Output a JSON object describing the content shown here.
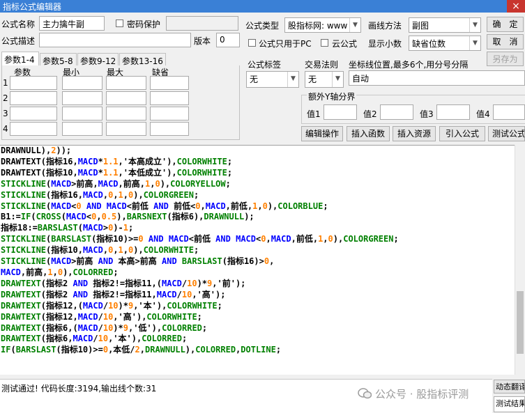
{
  "window": {
    "title": "指标公式编辑器",
    "close_glyph": "×"
  },
  "form": {
    "name_label": "公式名称",
    "name_value": "主力擒牛副",
    "password_label": "密码保护",
    "desc_label": "公式描述",
    "desc_value": "",
    "version_label": "版本",
    "version_value": "0",
    "type_label": "公式类型",
    "type_value": "股指标网: www",
    "draw_label": "画线方法",
    "draw_value": "副图",
    "pc_only_label": "公式只用于PC",
    "cloud_label": "云公式",
    "decimal_label": "显示小数",
    "decimal_value": "缺省位数"
  },
  "buttons": {
    "ok": "确　定",
    "cancel": "取　消",
    "save_as": "另存为",
    "edit_ops": "编辑操作",
    "insert_func": "插入函数",
    "insert_res": "插入资源",
    "import_formula": "引入公式",
    "test_formula": "测试公式"
  },
  "tabs": [
    "参数1-4",
    "参数5-8",
    "参数9-12",
    "参数13-16"
  ],
  "params": {
    "headers": [
      "参数",
      "最小",
      "最大",
      "缺省"
    ],
    "rows": [
      "1",
      "2",
      "3",
      "4"
    ]
  },
  "right_panel": {
    "tag_label": "公式标签",
    "tag_value": "无",
    "trade_label": "交易法则",
    "trade_value": "无",
    "coord_label": "坐标线位置,最多6个,用分号分隔",
    "coord_value": "自动",
    "extra_y_label": "额外Y轴分界",
    "value_labels": [
      "值1",
      "值2",
      "值3",
      "值4"
    ]
  },
  "status": {
    "message": "测试通过! 代码长度:3194,输出线个数:31"
  },
  "side_fragments": {
    "dynamic_translate": "动态翻译",
    "test_result": "测试结果"
  },
  "watermark": {
    "text": "公众号 · 股指标评测"
  },
  "colors": {
    "titlebar": "#3a80d6",
    "close": "#c8352e",
    "keyword_blue": "#0000ff",
    "green": "#008000",
    "number_orange": "#ff8000"
  },
  "code_lines": [
    [
      [
        "b",
        "DRAWNULL),"
      ],
      [
        "o",
        "2"
      ],
      [
        "b",
        "));"
      ]
    ],
    [
      [
        "b",
        "DRAWTEXT(指标16,"
      ],
      [
        "bl",
        "MACD"
      ],
      [
        "b",
        "*"
      ],
      [
        "o",
        "1.1"
      ],
      [
        "b",
        ",'本高成立'),"
      ],
      [
        "g",
        "COLORWHITE"
      ],
      [
        "b",
        ";"
      ]
    ],
    [
      [
        "b",
        "DRAWTEXT(指标10,"
      ],
      [
        "bl",
        "MACD"
      ],
      [
        "b",
        "*"
      ],
      [
        "o",
        "1.1"
      ],
      [
        "b",
        ",'本低成立'),"
      ],
      [
        "g",
        "COLORWHITE"
      ],
      [
        "b",
        ";"
      ]
    ],
    [
      [
        "g",
        "STICKLINE"
      ],
      [
        "b",
        "("
      ],
      [
        "bl",
        "MACD"
      ],
      [
        "b",
        ">前高,"
      ],
      [
        "bl",
        "MACD"
      ],
      [
        "b",
        ",前高,"
      ],
      [
        "o",
        "1"
      ],
      [
        "b",
        ","
      ],
      [
        "o",
        "0"
      ],
      [
        "b",
        "),"
      ],
      [
        "g",
        "COLORYELLOW"
      ],
      [
        "b",
        ";"
      ]
    ],
    [
      [
        "g",
        "STICKLINE"
      ],
      [
        "b",
        "(指标16,"
      ],
      [
        "bl",
        "MACD"
      ],
      [
        "b",
        ","
      ],
      [
        "o",
        "0"
      ],
      [
        "b",
        ","
      ],
      [
        "o",
        "1"
      ],
      [
        "b",
        ","
      ],
      [
        "o",
        "0"
      ],
      [
        "b",
        "),"
      ],
      [
        "g",
        "COLORGREEN"
      ],
      [
        "b",
        ";"
      ]
    ],
    [
      [
        "g",
        "STICKLINE"
      ],
      [
        "b",
        "("
      ],
      [
        "bl",
        "MACD"
      ],
      [
        "b",
        "<"
      ],
      [
        "o",
        "0"
      ],
      [
        "b",
        " "
      ],
      [
        "bl",
        "AND"
      ],
      [
        "b",
        " "
      ],
      [
        "bl",
        "MACD"
      ],
      [
        "b",
        "<前低 "
      ],
      [
        "bl",
        "AND"
      ],
      [
        "b",
        " 前低<"
      ],
      [
        "o",
        "0"
      ],
      [
        "b",
        ","
      ],
      [
        "bl",
        "MACD"
      ],
      [
        "b",
        ",前低,"
      ],
      [
        "o",
        "1"
      ],
      [
        "b",
        ","
      ],
      [
        "o",
        "0"
      ],
      [
        "b",
        "),"
      ],
      [
        "g",
        "COLORBLUE"
      ],
      [
        "b",
        ";"
      ]
    ],
    [
      [
        "b",
        "B1:="
      ],
      [
        "g",
        "IF"
      ],
      [
        "b",
        "("
      ],
      [
        "g",
        "CROSS"
      ],
      [
        "b",
        "("
      ],
      [
        "bl",
        "MACD"
      ],
      [
        "b",
        "<"
      ],
      [
        "o",
        "0"
      ],
      [
        "b",
        ","
      ],
      [
        "o",
        "0.5"
      ],
      [
        "b",
        "),"
      ],
      [
        "g",
        "BARSNEXT"
      ],
      [
        "b",
        "(指标6),"
      ],
      [
        "g",
        "DRAWNULL"
      ],
      [
        "b",
        ");"
      ]
    ],
    [
      [
        "b",
        "指标18:="
      ],
      [
        "g",
        "BARSLAST"
      ],
      [
        "b",
        "("
      ],
      [
        "bl",
        "MACD"
      ],
      [
        "b",
        ">"
      ],
      [
        "o",
        "0"
      ],
      [
        "b",
        ")-"
      ],
      [
        "o",
        "1"
      ],
      [
        "b",
        ";"
      ]
    ],
    [
      [
        "g",
        "STICKLINE"
      ],
      [
        "b",
        "("
      ],
      [
        "g",
        "BARSLAST"
      ],
      [
        "b",
        "(指标10)>="
      ],
      [
        "o",
        "0"
      ],
      [
        "b",
        " "
      ],
      [
        "bl",
        "AND"
      ],
      [
        "b",
        " "
      ],
      [
        "bl",
        "MACD"
      ],
      [
        "b",
        "<前低 "
      ],
      [
        "bl",
        "AND"
      ],
      [
        "b",
        " "
      ],
      [
        "bl",
        "MACD"
      ],
      [
        "b",
        "<"
      ],
      [
        "o",
        "0"
      ],
      [
        "b",
        ","
      ],
      [
        "bl",
        "MACD"
      ],
      [
        "b",
        ",前低,"
      ],
      [
        "o",
        "1"
      ],
      [
        "b",
        ","
      ],
      [
        "o",
        "0"
      ],
      [
        "b",
        "),"
      ],
      [
        "g",
        "COLORGREEN"
      ],
      [
        "b",
        ";"
      ]
    ],
    [
      [
        "g",
        "STICKLINE"
      ],
      [
        "b",
        "(指标10,"
      ],
      [
        "bl",
        "MACD"
      ],
      [
        "b",
        ","
      ],
      [
        "o",
        "0"
      ],
      [
        "b",
        ","
      ],
      [
        "o",
        "1"
      ],
      [
        "b",
        ","
      ],
      [
        "o",
        "0"
      ],
      [
        "b",
        "),"
      ],
      [
        "g",
        "COLORWHITE"
      ],
      [
        "b",
        ";"
      ]
    ],
    [
      [
        "g",
        "STICKLINE"
      ],
      [
        "b",
        "("
      ],
      [
        "bl",
        "MACD"
      ],
      [
        "b",
        ">前高 "
      ],
      [
        "bl",
        "AND"
      ],
      [
        "b",
        " 本高>前高 "
      ],
      [
        "bl",
        "AND"
      ],
      [
        "b",
        " "
      ],
      [
        "g",
        "BARSLAST"
      ],
      [
        "b",
        "(指标16)>"
      ],
      [
        "o",
        "0"
      ],
      [
        "b",
        ","
      ]
    ],
    [
      [
        "bl",
        "MACD"
      ],
      [
        "b",
        ",前高,"
      ],
      [
        "o",
        "1"
      ],
      [
        "b",
        ","
      ],
      [
        "o",
        "0"
      ],
      [
        "b",
        "),"
      ],
      [
        "g",
        "COLORRED"
      ],
      [
        "b",
        ";"
      ]
    ],
    [
      [
        "g",
        "DRAWTEXT"
      ],
      [
        "b",
        "(指标2 "
      ],
      [
        "bl",
        "AND"
      ],
      [
        "b",
        " 指标2!=指标11,("
      ],
      [
        "bl",
        "MACD"
      ],
      [
        "b",
        "/"
      ],
      [
        "o",
        "10"
      ],
      [
        "b",
        ")*"
      ],
      [
        "o",
        "9"
      ],
      [
        "b",
        ",'前');"
      ]
    ],
    [
      [
        "g",
        "DRAWTEXT"
      ],
      [
        "b",
        "(指标2 "
      ],
      [
        "bl",
        "AND"
      ],
      [
        "b",
        " 指标2!=指标11,"
      ],
      [
        "bl",
        "MACD"
      ],
      [
        "b",
        "/"
      ],
      [
        "o",
        "10"
      ],
      [
        "b",
        ",'高');"
      ]
    ],
    [
      [
        "g",
        "DRAWTEXT"
      ],
      [
        "b",
        "(指标12,("
      ],
      [
        "bl",
        "MACD"
      ],
      [
        "b",
        "/"
      ],
      [
        "o",
        "10"
      ],
      [
        "b",
        ")*"
      ],
      [
        "o",
        "9"
      ],
      [
        "b",
        ",'本'),"
      ],
      [
        "g",
        "COLORWHITE"
      ],
      [
        "b",
        ";"
      ]
    ],
    [
      [
        "g",
        "DRAWTEXT"
      ],
      [
        "b",
        "(指标12,"
      ],
      [
        "bl",
        "MACD"
      ],
      [
        "b",
        "/"
      ],
      [
        "o",
        "10"
      ],
      [
        "b",
        ",'高'),"
      ],
      [
        "g",
        "COLORWHITE"
      ],
      [
        "b",
        ";"
      ]
    ],
    [
      [
        "g",
        "DRAWTEXT"
      ],
      [
        "b",
        "(指标6,("
      ],
      [
        "bl",
        "MACD"
      ],
      [
        "b",
        "/"
      ],
      [
        "o",
        "10"
      ],
      [
        "b",
        ")*"
      ],
      [
        "o",
        "9"
      ],
      [
        "b",
        ",'低'),"
      ],
      [
        "g",
        "COLORRED"
      ],
      [
        "b",
        ";"
      ]
    ],
    [
      [
        "g",
        "DRAWTEXT"
      ],
      [
        "b",
        "(指标6,"
      ],
      [
        "bl",
        "MACD"
      ],
      [
        "b",
        "/"
      ],
      [
        "o",
        "10"
      ],
      [
        "b",
        ",'本'),"
      ],
      [
        "g",
        "COLORRED"
      ],
      [
        "b",
        ";"
      ]
    ],
    [
      [
        "g",
        "IF"
      ],
      [
        "b",
        "("
      ],
      [
        "g",
        "BARSLAST"
      ],
      [
        "b",
        "(指标10)>="
      ],
      [
        "o",
        "0"
      ],
      [
        "b",
        ",本低/"
      ],
      [
        "o",
        "2"
      ],
      [
        "b",
        ","
      ],
      [
        "g",
        "DRAWNULL"
      ],
      [
        "b",
        "),"
      ],
      [
        "g",
        "COLORRED"
      ],
      [
        "b",
        ","
      ],
      [
        "g",
        "DOTLINE"
      ],
      [
        "b",
        ";"
      ]
    ]
  ]
}
